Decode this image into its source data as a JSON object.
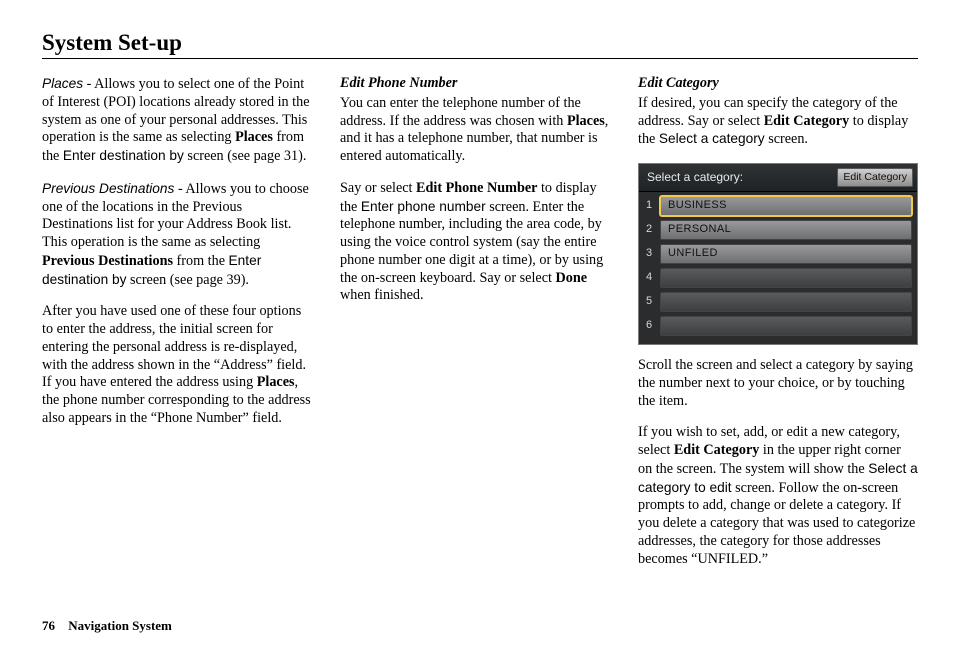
{
  "page_title": "System Set-up",
  "footer": {
    "page_number": "76",
    "label": "Navigation System"
  },
  "col1": {
    "places_label": "Places",
    "places_text": " - Allows you to select one of the Point of Interest (POI) locations already stored in the system as one of your personal addresses. This operation is the same as selecting ",
    "places_bold": "Places",
    "places_text2": " from the ",
    "enter_dest": "Enter destination by",
    "places_text3": " screen (see page 31).",
    "prev_label": "Previous Destinations",
    "prev_text": " - Allows you to choose one of the locations in the Previous Destinations list for your Address Book list. This operation is the same as selecting ",
    "prev_bold": "Previous Destinations",
    "prev_text2": " from the ",
    "prev_text3": " screen (see page 39).",
    "p3a": "After you have used one of these four options to enter the address, the initial screen for entering the personal address is re-displayed, with the address shown in the “Address” field. If you have entered the address using ",
    "p3_places": "Places",
    "p3b": ", the phone number corresponding to the address also appears in the “Phone Number” field."
  },
  "col2": {
    "heading": "Edit Phone Number",
    "p1a": "You can enter the telephone number of the address. If the address was chosen with ",
    "p1_places": "Places",
    "p1b": ", and it has a telephone number, that number is entered automatically.",
    "p2a": "Say or select ",
    "p2_bold": "Edit Phone Number",
    "p2b": " to display the ",
    "enter_phone": "Enter phone number",
    "p2c": " screen. Enter the telephone number, including the area code, by using the voice control system (say the entire phone number one digit at a time), or by using the on-screen keyboard. Say or select ",
    "done": "Done",
    "p2d": " when finished."
  },
  "col3": {
    "heading": "Edit Category",
    "p1a": "If desired, you can specify the category of the address. Say or select ",
    "p1_bold": "Edit Category",
    "p1b": " to display the ",
    "select_cat": "Select a category",
    "p1c": " screen.",
    "p2": "Scroll the screen and select a category by saying the number next to your choice, or by touching the item.",
    "p3a": "If you wish to set, add, or edit a new category, select ",
    "p3_bold": "Edit Category",
    "p3b": " in the upper right corner on the screen. The system will show the ",
    "select_edit": "Select a category to edit",
    "p3c": " screen. Follow the on-screen prompts to add, change or delete a category. If you delete a category that was used to categorize addresses, the category for those addresses becomes “UNFILED.”"
  },
  "screen": {
    "title": "Select a category:",
    "edit_button": "Edit Category",
    "rows": [
      {
        "num": "1",
        "label": "BUSINESS"
      },
      {
        "num": "2",
        "label": "PERSONAL"
      },
      {
        "num": "3",
        "label": "UNFILED"
      },
      {
        "num": "4",
        "label": ""
      },
      {
        "num": "5",
        "label": ""
      },
      {
        "num": "6",
        "label": ""
      }
    ]
  }
}
